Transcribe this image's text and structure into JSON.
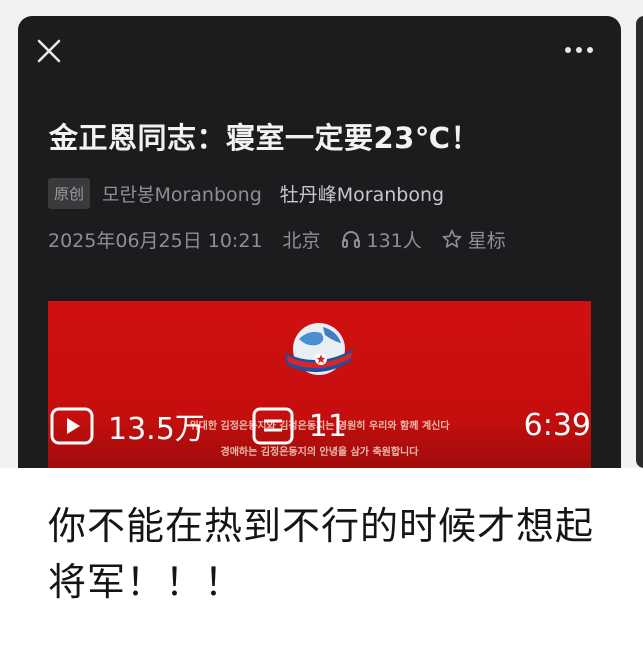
{
  "article": {
    "title": "金正恩同志：寝室一定要23℃！",
    "tag": "原创",
    "author": "모란봉Moranbong",
    "account": "牡丹峰Moranbong",
    "datetime": "2025年06月25日 10:21",
    "location": "北京",
    "listeners": "131人",
    "star_label": "星标"
  },
  "video": {
    "banner_line1": "위대한 김정은동지와 김정은동지는 영원히 우리와 함께 계신다",
    "banner_line2": "경애하는 김정은동지의 안녕을 삼가 축원합니다",
    "plays": "13.5万",
    "comments": "11",
    "duration": "6:39"
  },
  "caption": {
    "text": "你不能在热到不行的时候才想起将军！！！"
  },
  "icons": {
    "close": "close-icon",
    "more": "more-icon",
    "headphone": "headphone-icon",
    "star": "star-icon",
    "play": "play-icon",
    "comment": "comment-icon"
  },
  "colors": {
    "card_bg": "#1c1c1e",
    "video_red": "#d01010",
    "page_bg": "#f1f1f3"
  }
}
